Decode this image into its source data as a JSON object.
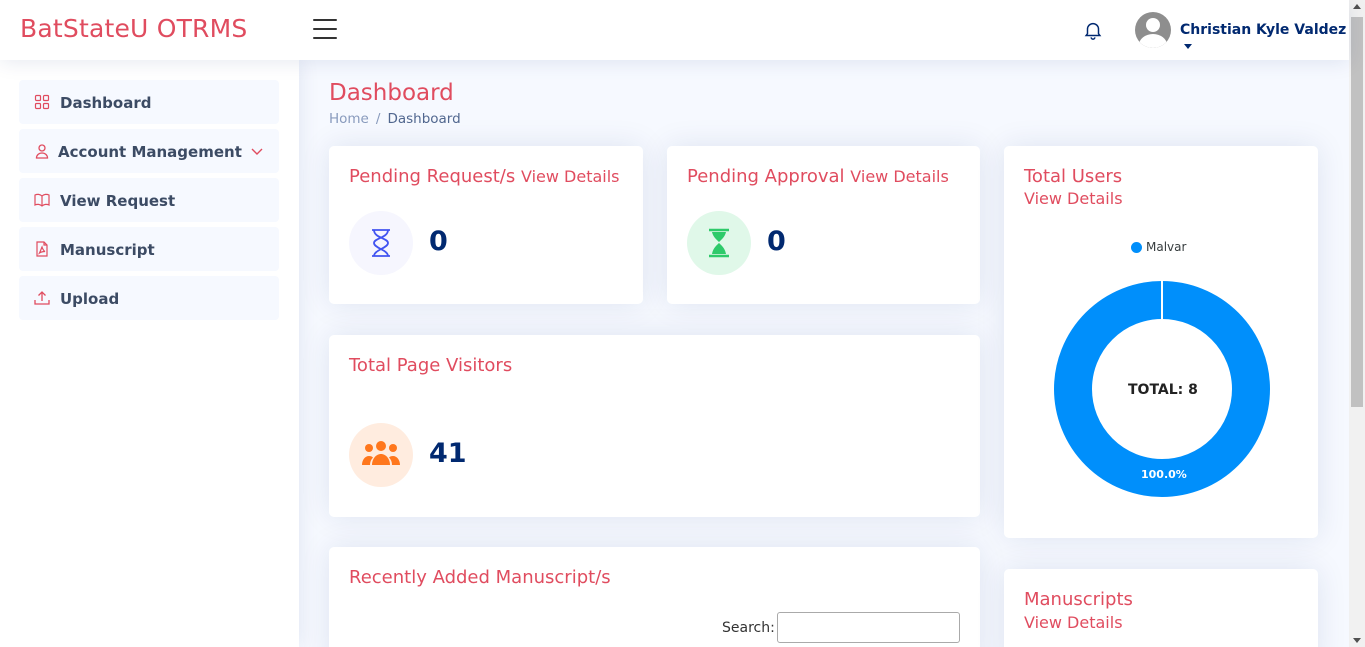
{
  "header": {
    "brand": "BatStateU OTRMS",
    "username": "Christian Kyle Valdez"
  },
  "sidebar": {
    "items": [
      {
        "label": "Dashboard",
        "icon": "grid-icon"
      },
      {
        "label": "Account Management",
        "icon": "person-icon"
      },
      {
        "label": "View Request",
        "icon": "book-icon"
      },
      {
        "label": "Manuscript",
        "icon": "file-pdf-icon"
      },
      {
        "label": "Upload",
        "icon": "upload-icon"
      }
    ]
  },
  "page": {
    "title": "Dashboard",
    "breadcrumb": [
      "Home",
      "Dashboard"
    ]
  },
  "cards": {
    "pending_requests": {
      "title": "Pending Request/s",
      "link": "View Details",
      "value": "0"
    },
    "pending_approval": {
      "title": "Pending Approval",
      "link": "View Details",
      "value": "0"
    },
    "total_visitors": {
      "title": "Total Page Visitors",
      "value": "41"
    },
    "recent_manuscripts": {
      "title": "Recently Added Manuscript/s",
      "search_label": "Search:",
      "search_value": ""
    },
    "total_users": {
      "title": "Total Users",
      "link": "View Details"
    },
    "manuscripts": {
      "title": "Manuscripts",
      "link": "View Details"
    }
  },
  "chart_data": {
    "type": "pie",
    "categories": [
      "Malvar"
    ],
    "values": [
      8
    ],
    "center_label": "TOTAL: 8",
    "slice_label": "100.0%",
    "legend_position": "top",
    "colors": [
      "#008ffb"
    ]
  },
  "colors": {
    "accent": "#e04c5f",
    "navy": "#012970",
    "blue": "#008ffb"
  }
}
